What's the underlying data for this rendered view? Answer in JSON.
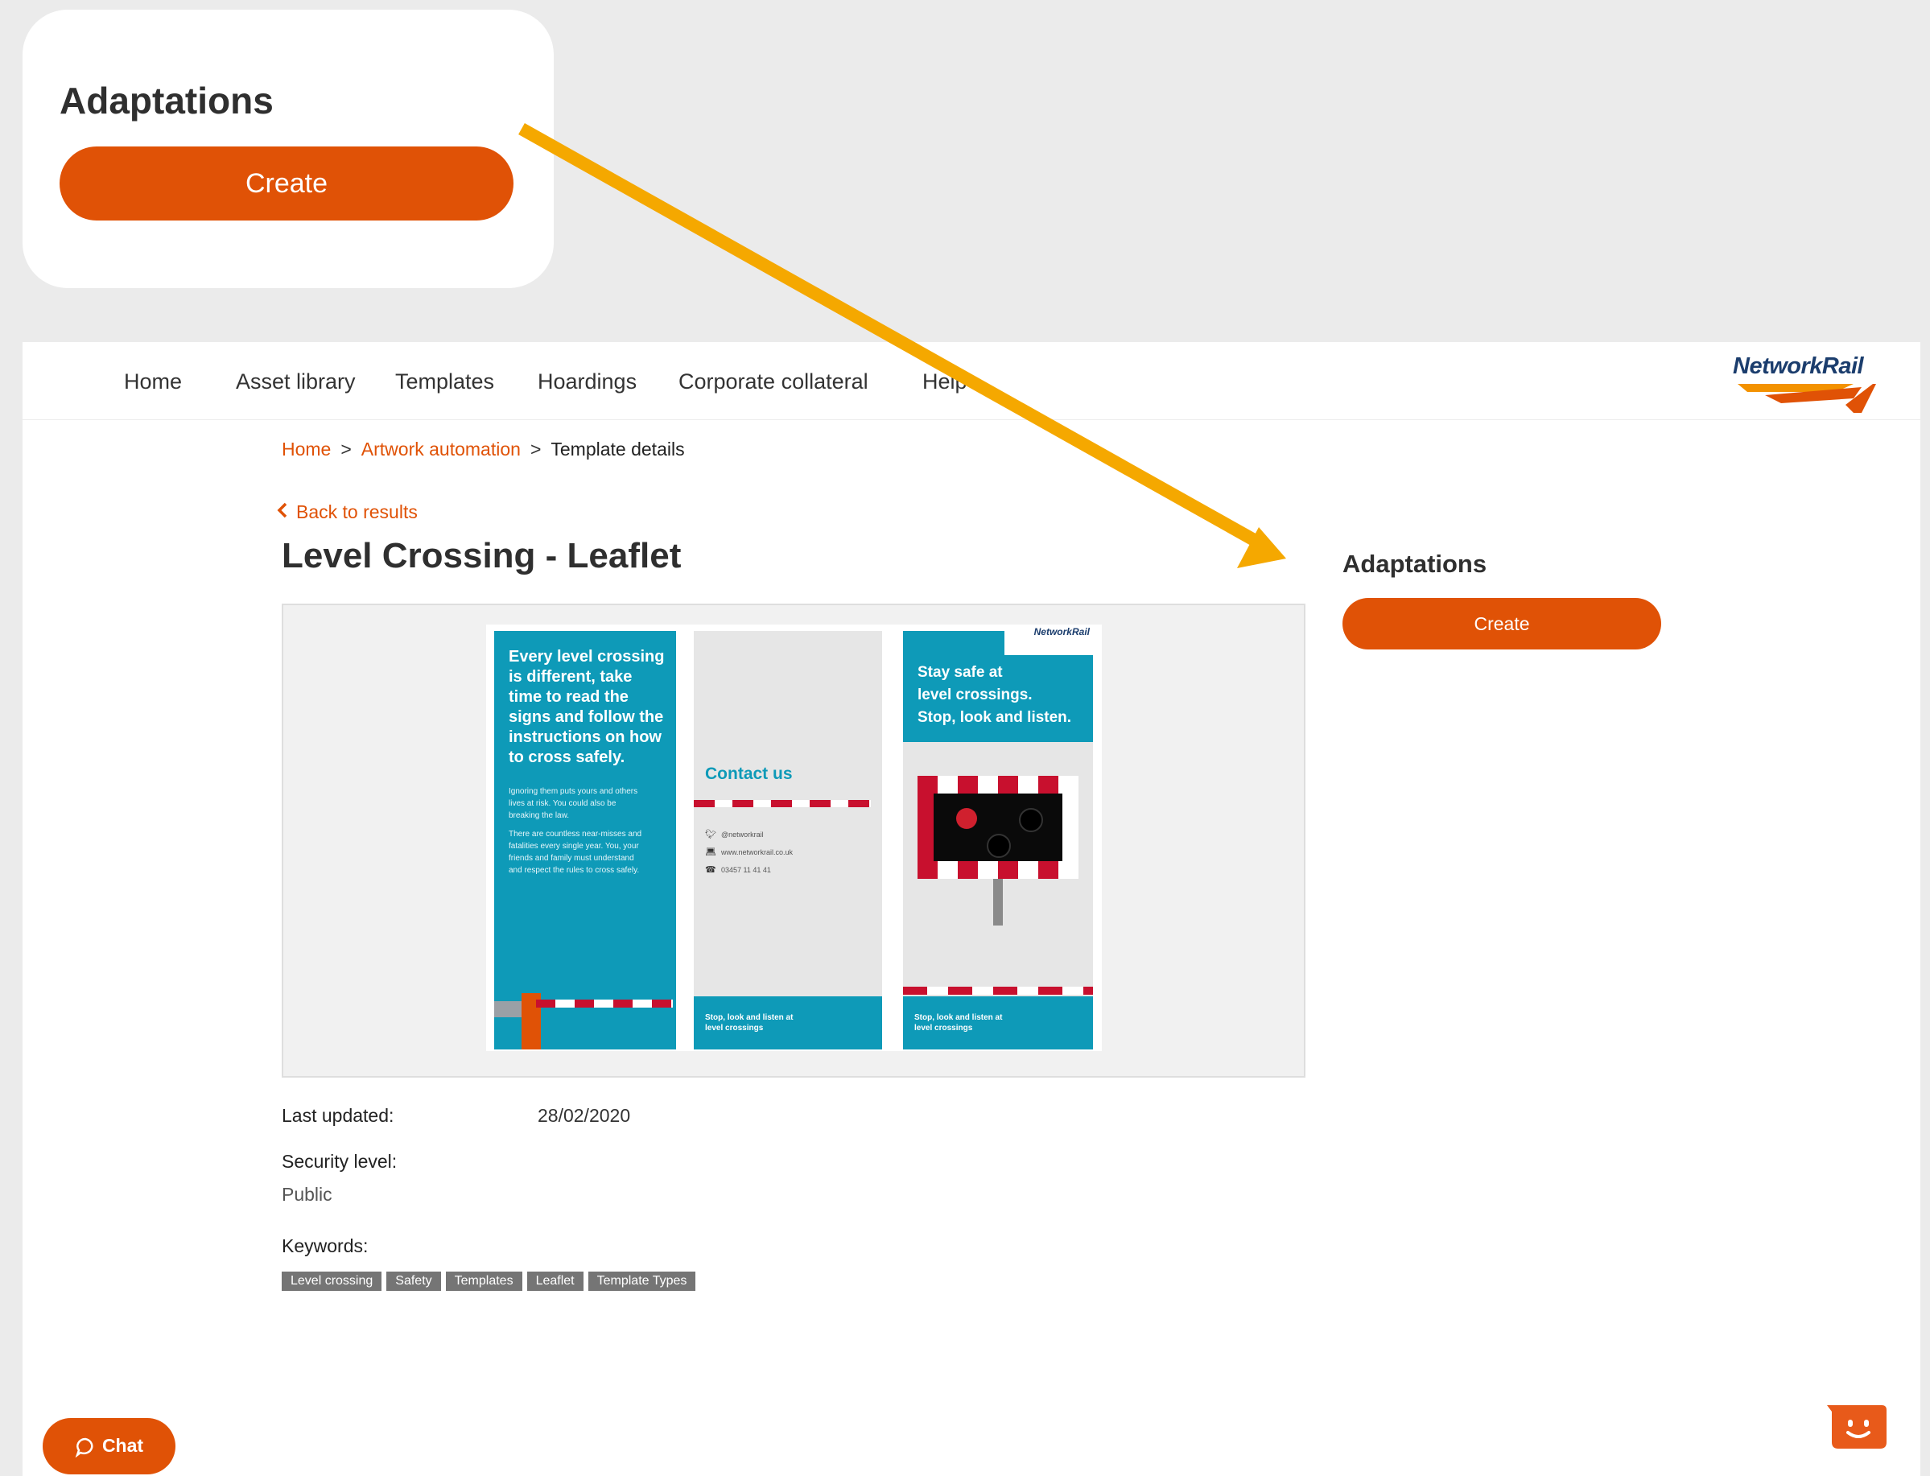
{
  "callout": {
    "title": "Adaptations",
    "button_label": "Create"
  },
  "nav": {
    "items": [
      "Home",
      "Asset library",
      "Templates",
      "Hoardings",
      "Corporate collateral",
      "Help"
    ],
    "logo_text": "NetworkRail"
  },
  "breadcrumb": {
    "items": [
      "Home",
      "Artwork automation"
    ],
    "separator": ">",
    "current": "Template details"
  },
  "back_link": "Back to results",
  "page_title": "Level Crossing - Leaflet",
  "leaflet": {
    "panel1_headline": "Every level crossing is different, take time to read the signs and follow the instructions on how to cross safely.",
    "panel1_body1": "Ignoring them puts yours and others lives at risk. You could also be breaking the law.",
    "panel1_body2": "There are countless near-misses and fatalities every single year. You, your friends and family must understand and respect the rules to cross safely.",
    "contact_title": "Contact us",
    "contact_twitter": "@networkrail",
    "contact_web": "www.networkrail.co.uk",
    "contact_phone": "03457 11 41 41",
    "footer_text": "Stop, look and listen at level crossings",
    "panel3_logo": "NetworkRail",
    "panel3_headline_1": "Stay safe at",
    "panel3_headline_2": "level crossings.",
    "panel3_headline_3": "Stop, look and listen."
  },
  "meta": {
    "last_updated_label": "Last updated:",
    "last_updated_value": "28/02/2020",
    "security_label": "Security level:",
    "security_value": "Public",
    "keywords_label": "Keywords:",
    "keywords": [
      "Level crossing",
      "Safety",
      "Templates",
      "Leaflet",
      "Template Types"
    ]
  },
  "adaptations": {
    "title": "Adaptations",
    "button_label": "Create"
  },
  "chat": {
    "label": "Chat"
  },
  "colors": {
    "brand_orange": "#e05206",
    "arrow_yellow": "#f5a800",
    "leaflet_teal": "#0e9ab8",
    "logo_navy": "#1b3d6d"
  },
  "icons": [
    "chevron-left-icon",
    "chat-bubble-icon",
    "twitter-icon",
    "laptop-icon",
    "phone-icon",
    "bot-icon"
  ]
}
